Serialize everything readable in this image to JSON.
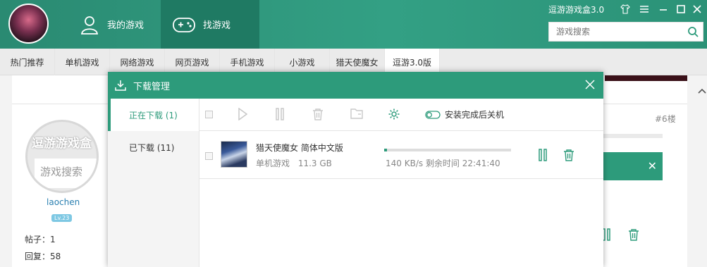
{
  "header": {
    "nav_my_games": "我的游戏",
    "nav_find_games": "找游戏",
    "app_title": "逗游游戏盒3.0",
    "search_placeholder": "游戏搜索"
  },
  "tabs": [
    {
      "label": "热门推荐"
    },
    {
      "label": "单机游戏"
    },
    {
      "label": "网络游戏"
    },
    {
      "label": "网页游戏"
    },
    {
      "label": "手机游戏"
    },
    {
      "label": "小游戏"
    },
    {
      "label": "猎天使魔女"
    },
    {
      "label": "逗游3.0版"
    }
  ],
  "background": {
    "profile_banner_top": "逗游游戏盒",
    "profile_banner_bottom": "游戏搜索",
    "username": "laochen",
    "level": "Lv.23",
    "posts": "帖子：1",
    "replies": "回复：58",
    "floor": "#6楼"
  },
  "download_manager": {
    "title": "下载管理",
    "sidebar": [
      {
        "label": "正在下载 (1)"
      },
      {
        "label": "已下载 (11)"
      }
    ],
    "shutdown_option": "安装完成后关机",
    "items": [
      {
        "name": "猎天使魔女 简体中文版",
        "category": "单机游戏",
        "size": "11.3 GB",
        "status": "140 KB/s 剩余时间 22:41:40",
        "progress": 0.02
      }
    ]
  },
  "colors": {
    "accent": "#2d9b7b",
    "header_dark": "#1f7a63"
  }
}
